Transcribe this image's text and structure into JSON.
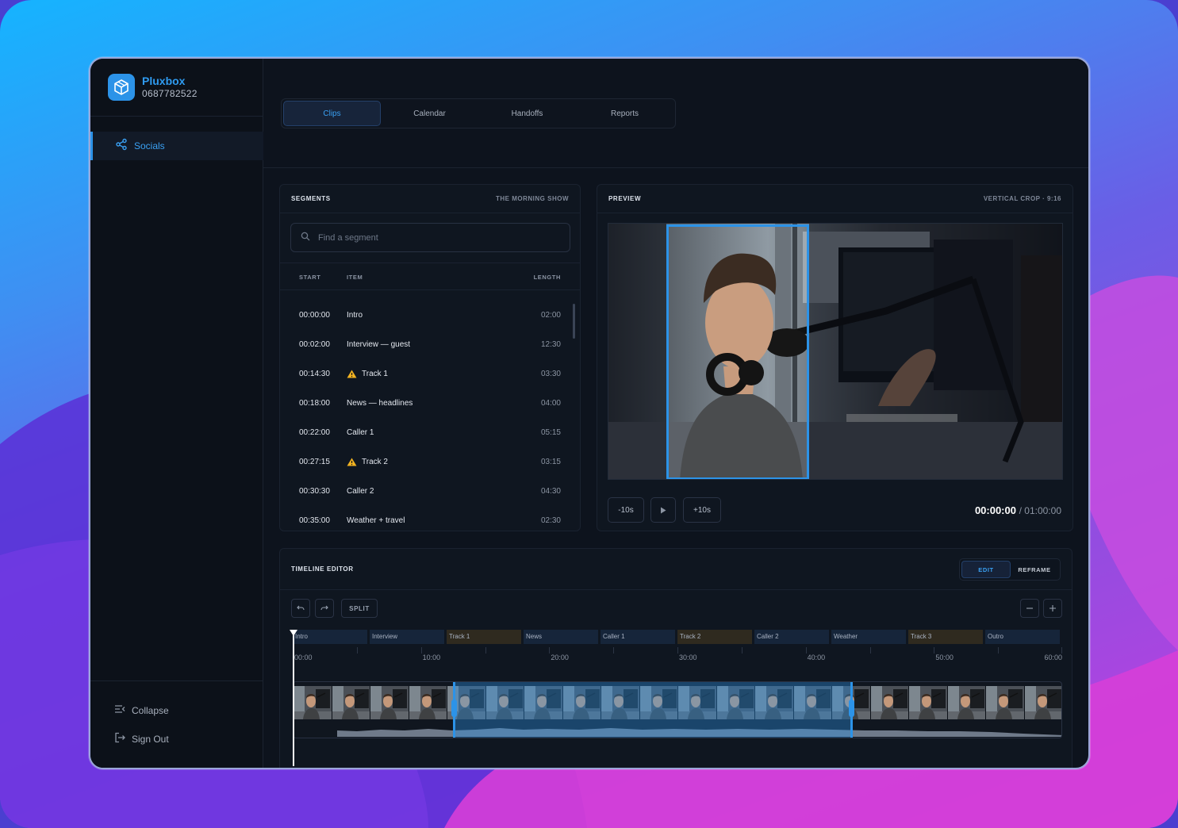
{
  "brand": {
    "name": "Pluxbox",
    "id": "0687782522"
  },
  "sidebar": {
    "items": [
      {
        "label": "Socials",
        "icon": "share-icon",
        "active": true
      }
    ],
    "collapse_label": "Collapse",
    "signout_label": "Sign Out"
  },
  "tabs": [
    {
      "label": "Clips",
      "active": true
    },
    {
      "label": "Calendar",
      "active": false
    },
    {
      "label": "Handoffs",
      "active": false
    },
    {
      "label": "Reports",
      "active": false
    }
  ],
  "segments": {
    "title": "SEGMENTS",
    "show": "THE MORNING SHOW",
    "search_placeholder": "Find a segment",
    "columns": {
      "start": "START",
      "item": "ITEM",
      "length": "LENGTH"
    },
    "rows": [
      {
        "start": "00:00:00",
        "item": "Intro",
        "length": "02:00",
        "warning": false
      },
      {
        "start": "00:02:00",
        "item": "Interview — guest",
        "length": "12:30",
        "warning": false
      },
      {
        "start": "00:14:30",
        "item": "Track 1",
        "length": "03:30",
        "warning": true
      },
      {
        "start": "00:18:00",
        "item": "News — headlines",
        "length": "04:00",
        "warning": false
      },
      {
        "start": "00:22:00",
        "item": "Caller 1",
        "length": "05:15",
        "warning": false
      },
      {
        "start": "00:27:15",
        "item": "Track 2",
        "length": "03:15",
        "warning": true
      },
      {
        "start": "00:30:30",
        "item": "Caller 2",
        "length": "04:30",
        "warning": false
      },
      {
        "start": "00:35:00",
        "item": "Weather + travel",
        "length": "02:30",
        "warning": false
      }
    ]
  },
  "preview": {
    "title": "PREVIEW",
    "mode": "VERTICAL CROP · 9:16",
    "back_label": "-10s",
    "forward_label": "+10s",
    "current_time": "00:00:00",
    "total_time": "/ 01:00:00"
  },
  "timeline": {
    "title": "TIMELINE EDITOR",
    "modes": [
      {
        "label": "EDIT",
        "active": true
      },
      {
        "label": "REFRAME",
        "active": false
      }
    ],
    "split_label": "SPLIT",
    "segments": [
      {
        "label": "Intro",
        "kind": "talk"
      },
      {
        "label": "Interview",
        "kind": "talk"
      },
      {
        "label": "Track 1",
        "kind": "music"
      },
      {
        "label": "News",
        "kind": "talk"
      },
      {
        "label": "Caller 1",
        "kind": "talk"
      },
      {
        "label": "Track 2",
        "kind": "music"
      },
      {
        "label": "Caller 2",
        "kind": "talk"
      },
      {
        "label": "Weather",
        "kind": "talk"
      },
      {
        "label": "Track 3",
        "kind": "music"
      },
      {
        "label": "Outro",
        "kind": "talk"
      }
    ],
    "ticks": [
      "00:00",
      "10:00",
      "20:00",
      "30:00",
      "40:00",
      "50:00",
      "60:00"
    ],
    "selection_range_fraction": [
      0.207,
      0.727
    ],
    "playhead_fraction": 0
  },
  "colors": {
    "accent": "#2c93e8",
    "warning": "#f2b321",
    "music": "#2f2a1f",
    "talk": "#16253a"
  }
}
